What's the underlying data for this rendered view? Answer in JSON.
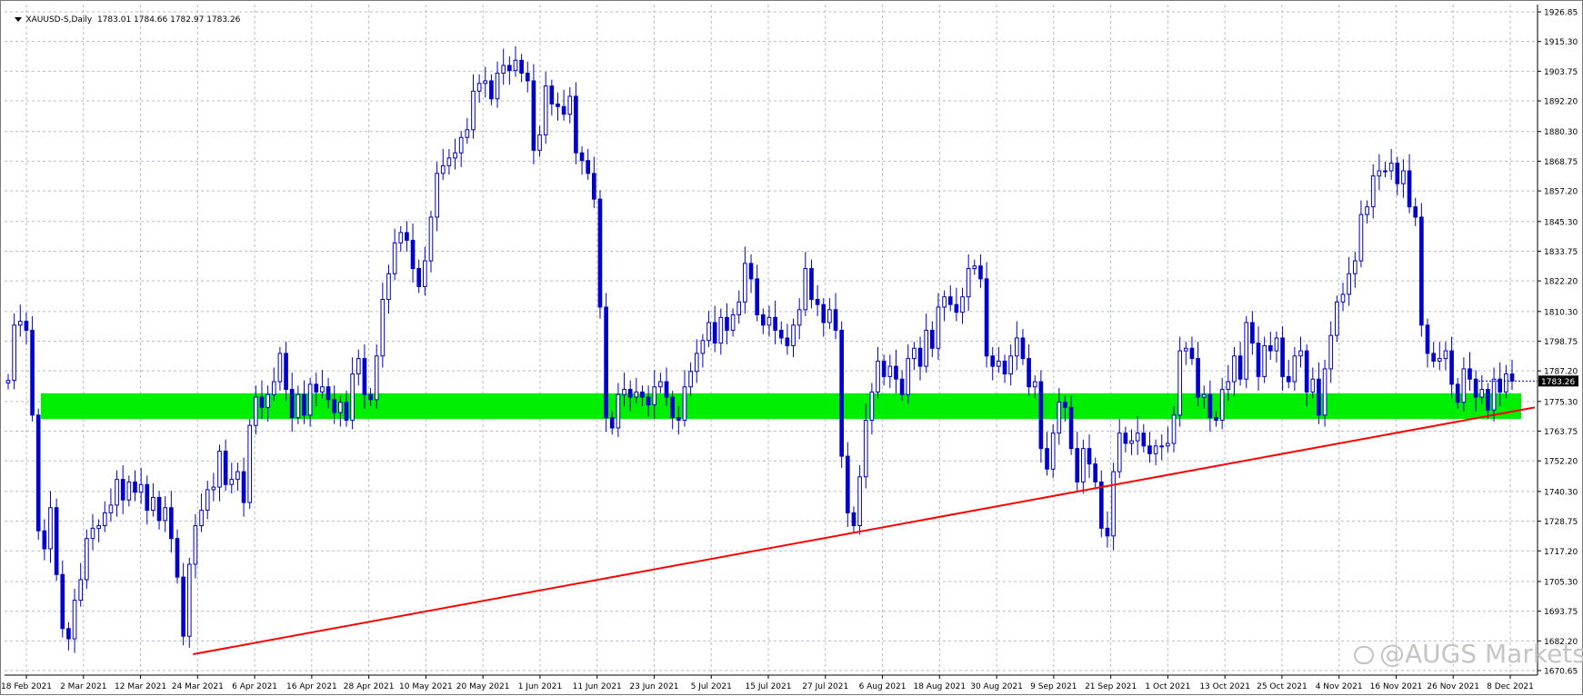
{
  "window": {
    "symbol": "XAUUSD-S",
    "timeframe": "Daily",
    "ohlc": "1783.01 1784.66 1782.97 1783.26"
  },
  "watermark": {
    "text": "@AUGS Markets",
    "icon": "chat-bubble-icon"
  },
  "colors": {
    "candle": "#0000cc",
    "grid": "#b4bcc8",
    "zone": "#00ee00",
    "trendline": "#ff0000",
    "price_label_bg": "#000000"
  },
  "chart_data": {
    "type": "candlestick",
    "title": "XAUUSD-S,Daily",
    "price_axis_ticks": [
      "1926.85",
      "1915.30",
      "1903.75",
      "1892.20",
      "1880.30",
      "1868.75",
      "1857.20",
      "1845.30",
      "1833.75",
      "1822.20",
      "1810.30",
      "1798.75",
      "1787.20",
      "1775.30",
      "1763.75",
      "1752.20",
      "1740.30",
      "1728.75",
      "1717.20",
      "1705.30",
      "1693.75",
      "1682.20",
      "1670.65"
    ],
    "date_axis_ticks": [
      "18 Feb 2021",
      "2 Mar 2021",
      "12 Mar 2021",
      "24 Mar 2021",
      "6 Apr 2021",
      "16 Apr 2021",
      "28 Apr 2021",
      "10 May 2021",
      "20 May 2021",
      "1 Jun 2021",
      "11 Jun 2021",
      "23 Jun 2021",
      "5 Jul 2021",
      "15 Jul 2021",
      "27 Jul 2021",
      "6 Aug 2021",
      "18 Aug 2021",
      "30 Aug 2021",
      "9 Sep 2021",
      "21 Sep 2021",
      "1 Oct 2021",
      "13 Oct 2021",
      "25 Oct 2021",
      "4 Nov 2021",
      "16 Nov 2021",
      "26 Nov 2021",
      "8 Dec 2021"
    ],
    "current_price": "1783.26",
    "ylim": [
      1670.65,
      1926.85
    ],
    "support_zone": [
      1768.5,
      1778.5
    ],
    "trendline": {
      "start": [
        "24 Mar 2021",
        1677.0
      ],
      "end": [
        "8 Dec 2021",
        1773.0
      ]
    },
    "closes": [
      1783.5,
      1805.0,
      1806.5,
      1803.0,
      1770.0,
      1725.0,
      1718.0,
      1734.0,
      1708.0,
      1687.0,
      1683.0,
      1698.0,
      1706.0,
      1722.0,
      1726.0,
      1727.0,
      1732.0,
      1735.0,
      1745.0,
      1737.0,
      1744.0,
      1740.0,
      1743.0,
      1733.0,
      1738.0,
      1729.0,
      1734.0,
      1722.0,
      1707.0,
      1684.0,
      1712.0,
      1727.0,
      1733.0,
      1741.0,
      1742.0,
      1756.0,
      1743.0,
      1745.0,
      1748.0,
      1736.0,
      1766.0,
      1777.0,
      1773.0,
      1778.0,
      1783.0,
      1794.0,
      1780.0,
      1769.0,
      1778.0,
      1770.0,
      1782.0,
      1779.0,
      1781.0,
      1776.0,
      1771.0,
      1775.0,
      1768.0,
      1786.0,
      1792.0,
      1778.0,
      1776.0,
      1793.0,
      1815.0,
      1825.0,
      1837.0,
      1841.0,
      1838.0,
      1827.0,
      1820.0,
      1830.0,
      1847.0,
      1864.0,
      1867.0,
      1870.0,
      1872.0,
      1878.0,
      1881.0,
      1896.0,
      1899.0,
      1900.0,
      1893.0,
      1903.0,
      1906.0,
      1904.0,
      1908.0,
      1903.0,
      1900.0,
      1873.0,
      1879.0,
      1898.0,
      1891.0,
      1890.0,
      1887.0,
      1894.0,
      1872.0,
      1869.0,
      1864.0,
      1854.0,
      1812.0,
      1769.0,
      1765.0,
      1778.0,
      1780.0,
      1777.0,
      1779.0,
      1777.0,
      1774.0,
      1781.0,
      1783.0,
      1777.0,
      1769.0,
      1768.0,
      1781.0,
      1787.0,
      1794.0,
      1799.0,
      1806.0,
      1798.0,
      1808.0,
      1803.0,
      1809.0,
      1814.0,
      1829.0,
      1823.0,
      1809.0,
      1805.0,
      1808.0,
      1803.0,
      1800.0,
      1797.0,
      1805.0,
      1811.0,
      1827.0,
      1815.0,
      1813.0,
      1806.0,
      1811.0,
      1803.0,
      1754.0,
      1732.0,
      1727.0,
      1746.0,
      1768.0,
      1779.0,
      1791.0,
      1785.0,
      1789.0,
      1784.0,
      1778.0,
      1792.0,
      1796.0,
      1789.0,
      1803.0,
      1796.0,
      1812.0,
      1816.0,
      1813.0,
      1810.0,
      1816.0,
      1827.0,
      1828.0,
      1823.0,
      1793.0,
      1789.0,
      1791.0,
      1786.0,
      1793.0,
      1800.0,
      1792.0,
      1781.0,
      1783.0,
      1757.0,
      1749.0,
      1763.0,
      1775.0,
      1773.0,
      1757.0,
      1744.0,
      1757.0,
      1751.0,
      1744.0,
      1726.0,
      1723.0,
      1748.0,
      1763.0,
      1759.0,
      1760.0,
      1763.0,
      1758.0,
      1755.0,
      1758.0,
      1758.0,
      1759.0,
      1770.0,
      1795.0,
      1796.0,
      1792.0,
      1777.0,
      1778.0,
      1769.0,
      1768.0,
      1780.0,
      1783.0,
      1793.0,
      1784.0,
      1806.0,
      1798.0,
      1785.0,
      1797.0,
      1795.0,
      1800.0,
      1785.0,
      1783.0,
      1793.0,
      1795.0,
      1779.0,
      1784.0,
      1770.0,
      1788.0,
      1801.0,
      1814.0,
      1817.0,
      1825.0,
      1830.0,
      1848.0,
      1851.0,
      1863.0,
      1865.0,
      1865.0,
      1868.0,
      1860.0,
      1865.0,
      1851.0,
      1847.0,
      1805.0,
      1794.0,
      1791.0,
      1792.0,
      1795.0,
      1782.0,
      1775.0,
      1788.0,
      1784.0,
      1777.0,
      1780.0,
      1772.0,
      1784.0,
      1779.0,
      1786.0,
      1783.26
    ]
  }
}
